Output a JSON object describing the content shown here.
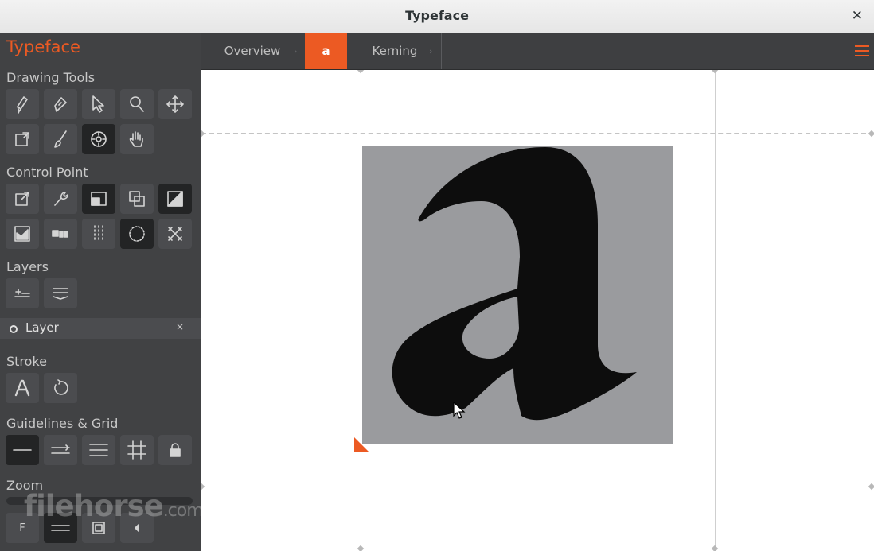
{
  "window": {
    "title": "Typeface",
    "close_glyph": "✕"
  },
  "sidebar": {
    "app_name": "Typeface",
    "sections": {
      "drawing_tools": "Drawing Tools",
      "control_point": "Control Point",
      "layers": "Layers",
      "stroke": "Stroke",
      "guidelines": "Guidelines & Grid",
      "zoom": "Zoom"
    },
    "drawing_tools": [
      "pen-icon",
      "bezier-pen-icon",
      "select-arrow-icon",
      "zoom-magnifier-icon",
      "move-icon",
      "resize-icon",
      "brush-icon",
      "point-select-icon",
      "hand-icon"
    ],
    "control_points": [
      "tie-point-icon",
      "wrench-icon",
      "corner-icon",
      "union-icon",
      "contrast-icon",
      "image-icon",
      "dots-row-icon",
      "dots-grid-icon",
      "circle-dotted-icon",
      "delete-points-icon"
    ],
    "layer_tools": [
      "add-layer-icon",
      "layer-list-icon"
    ],
    "layer": {
      "name": "Layer",
      "remove": "×"
    },
    "stroke_tools": [
      "text-stroke-icon",
      "rotate-icon"
    ],
    "guideline_tools": [
      "baseline-icon",
      "lines-icon",
      "lines-multi-icon",
      "grid-icon",
      "lock-icon"
    ],
    "zoom_tools": {
      "fit_label": "F"
    },
    "watermark": {
      "name": "filehorse",
      "suffix": ".com"
    }
  },
  "tabs": [
    {
      "label": "Overview",
      "active": false
    },
    {
      "label": "a",
      "active": true
    },
    {
      "label": "Kerning",
      "active": false
    }
  ],
  "colors": {
    "accent": "#ec5a23",
    "sidebar": "#414244",
    "canvas": "#ffffff"
  }
}
